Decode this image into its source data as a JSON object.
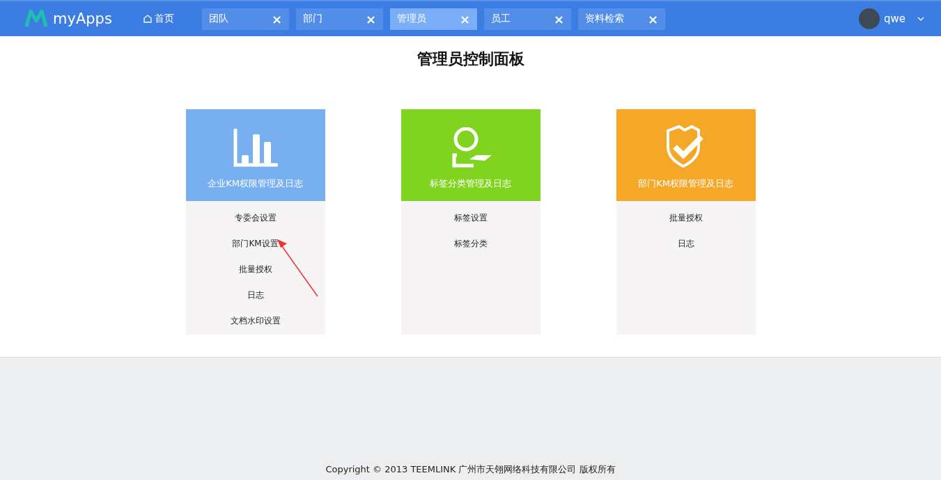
{
  "header": {
    "logo": "myApps",
    "home": "首页",
    "tabs": [
      {
        "label": "团队",
        "selected": false,
        "close": "×"
      },
      {
        "label": "部门",
        "selected": false,
        "close": "×"
      },
      {
        "label": "管理员",
        "selected": true,
        "close": "×"
      },
      {
        "label": "员工",
        "selected": false,
        "close": "×"
      },
      {
        "label": "资料检索",
        "selected": false,
        "close": "×"
      }
    ],
    "user": "qwe"
  },
  "title": "管理员控制面板",
  "cards": [
    {
      "kind": "chart",
      "color": "#77aff0",
      "title": "企业KM权限管理及日志",
      "items": [
        "专委会设置",
        "部门KM设置",
        "批量授权",
        "日志",
        "文档水印设置"
      ]
    },
    {
      "kind": "person",
      "color": "#80d420",
      "title": "标签分类管理及日志",
      "items": [
        "标签设置",
        "标签分类"
      ]
    },
    {
      "kind": "shield",
      "color": "#f5a827",
      "title": "部门KM权限管理及日志",
      "items": [
        "批量授权",
        "日志"
      ]
    }
  ],
  "footer": "Copyright © 2013 TEEMLINK 广州市天翎网络科技有限公司 版权所有"
}
